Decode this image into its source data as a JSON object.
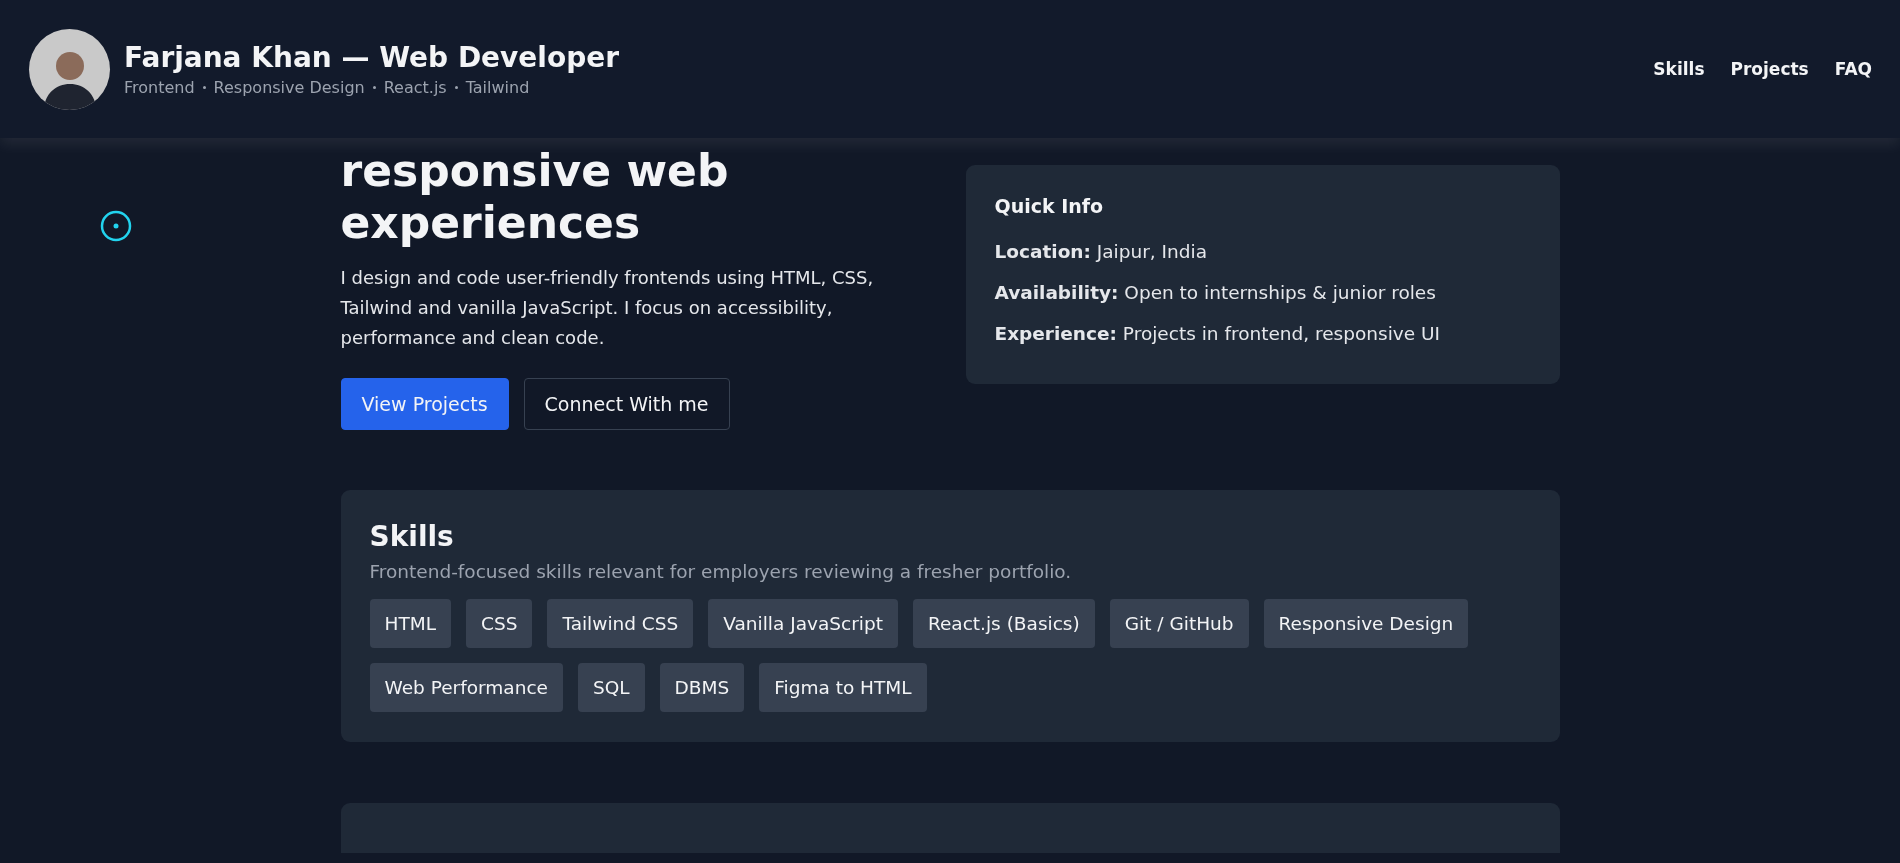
{
  "header": {
    "name": "Farjana Khan — Web Developer",
    "tags": [
      "Frontend",
      "Responsive Design",
      "React.js",
      "Tailwind"
    ],
    "nav": [
      "Skills",
      "Projects",
      "FAQ"
    ]
  },
  "hero": {
    "title_lines": [
      "responsive web",
      "experiences"
    ],
    "description": "I design and code user-friendly frontends using HTML, CSS, Tailwind and vanilla JavaScript. I focus on accessibility, performance and clean code.",
    "buttons": [
      {
        "label": "View Projects",
        "kind": "primary"
      },
      {
        "label": "Connect With me",
        "kind": "outline"
      }
    ]
  },
  "quick_info": {
    "title": "Quick Info",
    "items": [
      {
        "label": "Location:",
        "value": "Jaipur, India"
      },
      {
        "label": "Availability:",
        "value": "Open to internships & junior roles"
      },
      {
        "label": "Experience:",
        "value": "Projects in frontend, responsive UI"
      }
    ]
  },
  "skills": {
    "title": "Skills",
    "subtitle": "Frontend-focused skills relevant for employers reviewing a fresher portfolio.",
    "items": [
      "HTML",
      "CSS",
      "Tailwind CSS",
      "Vanilla JavaScript",
      "React.js (Basics)",
      "Git / GitHub",
      "Responsive Design",
      "Web Performance",
      "SQL",
      "DBMS",
      "Figma to HTML"
    ]
  }
}
